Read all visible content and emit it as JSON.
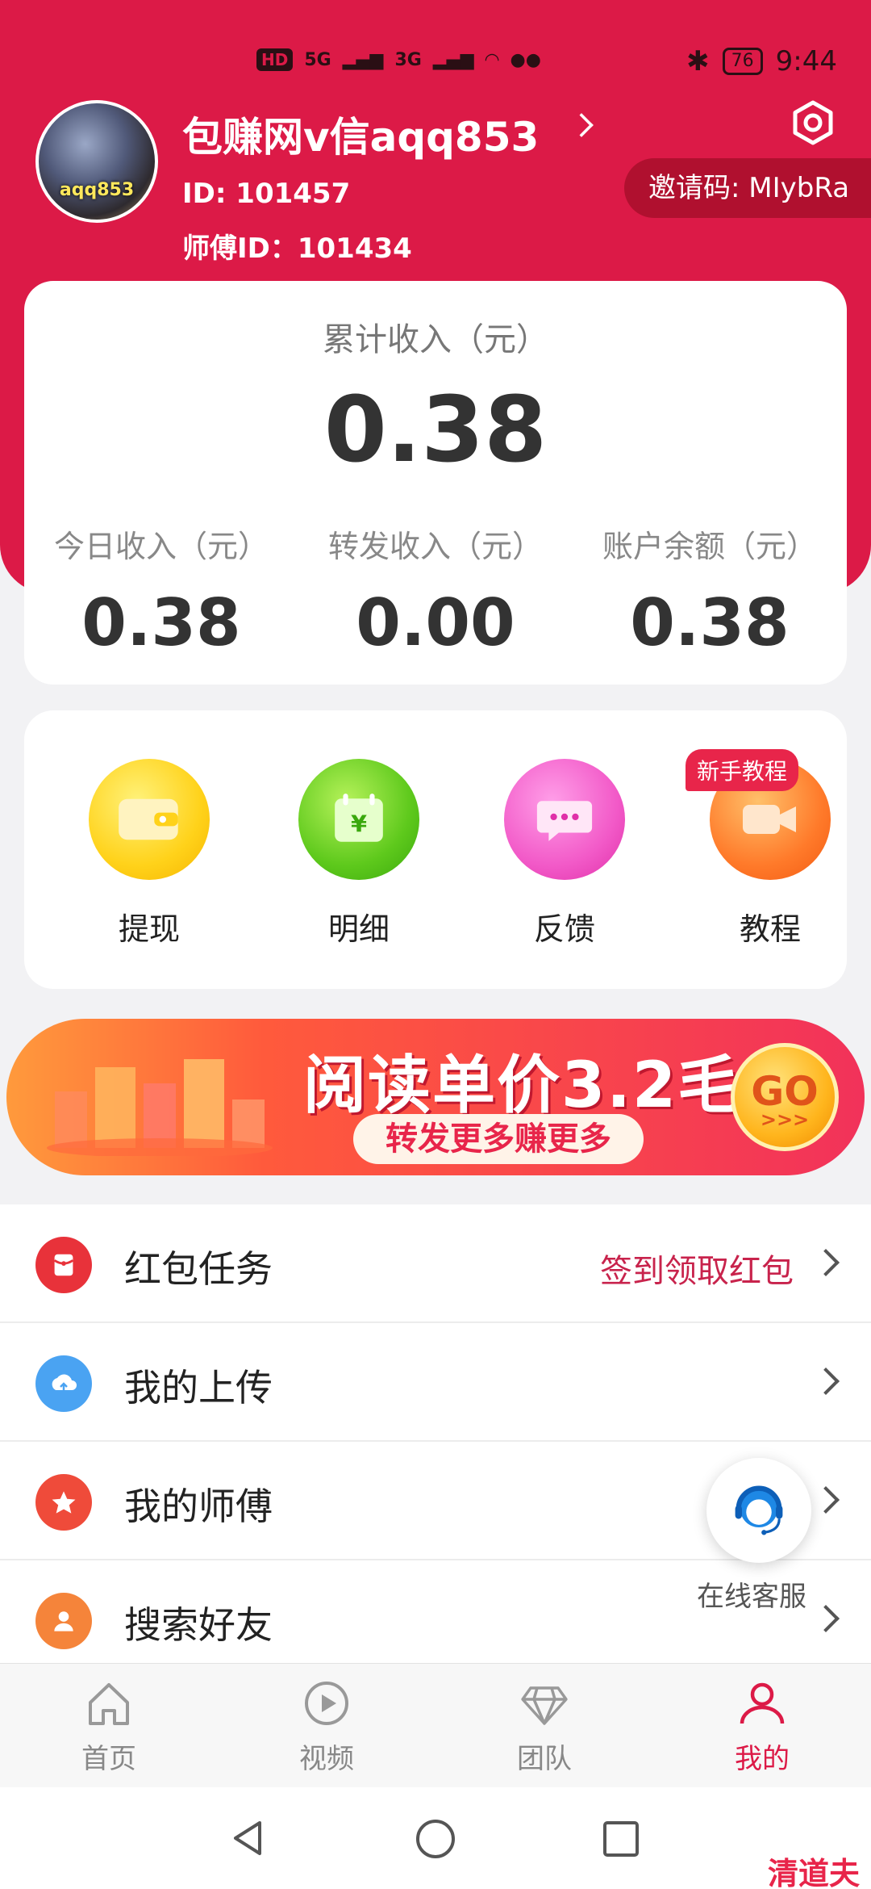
{
  "status_bar": {
    "network_left": [
      "HD",
      "5G",
      "3G"
    ],
    "battery": "76",
    "time": "9:44"
  },
  "profile": {
    "avatar_text": "aqq853",
    "username": "包赚网v信aqq853",
    "id": "ID: 101457",
    "master_id": "师傅ID：101434",
    "invite_code": "邀请码: MIybRa"
  },
  "income": {
    "total_label": "累计收入（元）",
    "total_value": "0.38",
    "stats": [
      {
        "label": "今日收入（元）",
        "value": "0.38"
      },
      {
        "label": "转发收入（元）",
        "value": "0.00"
      },
      {
        "label": "账户余额（元）",
        "value": "0.38"
      }
    ]
  },
  "actions": [
    {
      "label": "提现",
      "icon": "wallet-icon"
    },
    {
      "label": "明细",
      "icon": "calendar-yuan-icon"
    },
    {
      "label": "反馈",
      "icon": "chat-bubble-icon"
    },
    {
      "label": "教程",
      "icon": "video-camera-icon",
      "badge": "新手教程"
    }
  ],
  "banner": {
    "title": "阅读单价3.2毛",
    "subtitle": "转发更多赚更多",
    "go": "GO",
    "go_arrows": ">>>"
  },
  "list": [
    {
      "label": "红包任务",
      "extra": "签到领取红包",
      "icon": "red-envelope-icon",
      "color": "#e8323a"
    },
    {
      "label": "我的上传",
      "extra": "",
      "icon": "cloud-upload-icon",
      "color": "#4aa3f2"
    },
    {
      "label": "我的师傅",
      "extra": "",
      "icon": "star-icon",
      "color": "#ef4b3a"
    },
    {
      "label": "搜索好友",
      "extra": "",
      "icon": "person-icon",
      "color": "#f5843a"
    }
  ],
  "customer_service": {
    "label": "在线客服"
  },
  "bottom_nav": [
    {
      "label": "首页",
      "icon": "home-icon",
      "active": false
    },
    {
      "label": "视频",
      "icon": "play-icon",
      "active": false
    },
    {
      "label": "团队",
      "icon": "diamond-icon",
      "active": false
    },
    {
      "label": "我的",
      "icon": "user-icon",
      "active": true
    }
  ],
  "watermark": "清道夫",
  "colors": {
    "brand": "#dc1a47",
    "accent": "#e8254a"
  }
}
